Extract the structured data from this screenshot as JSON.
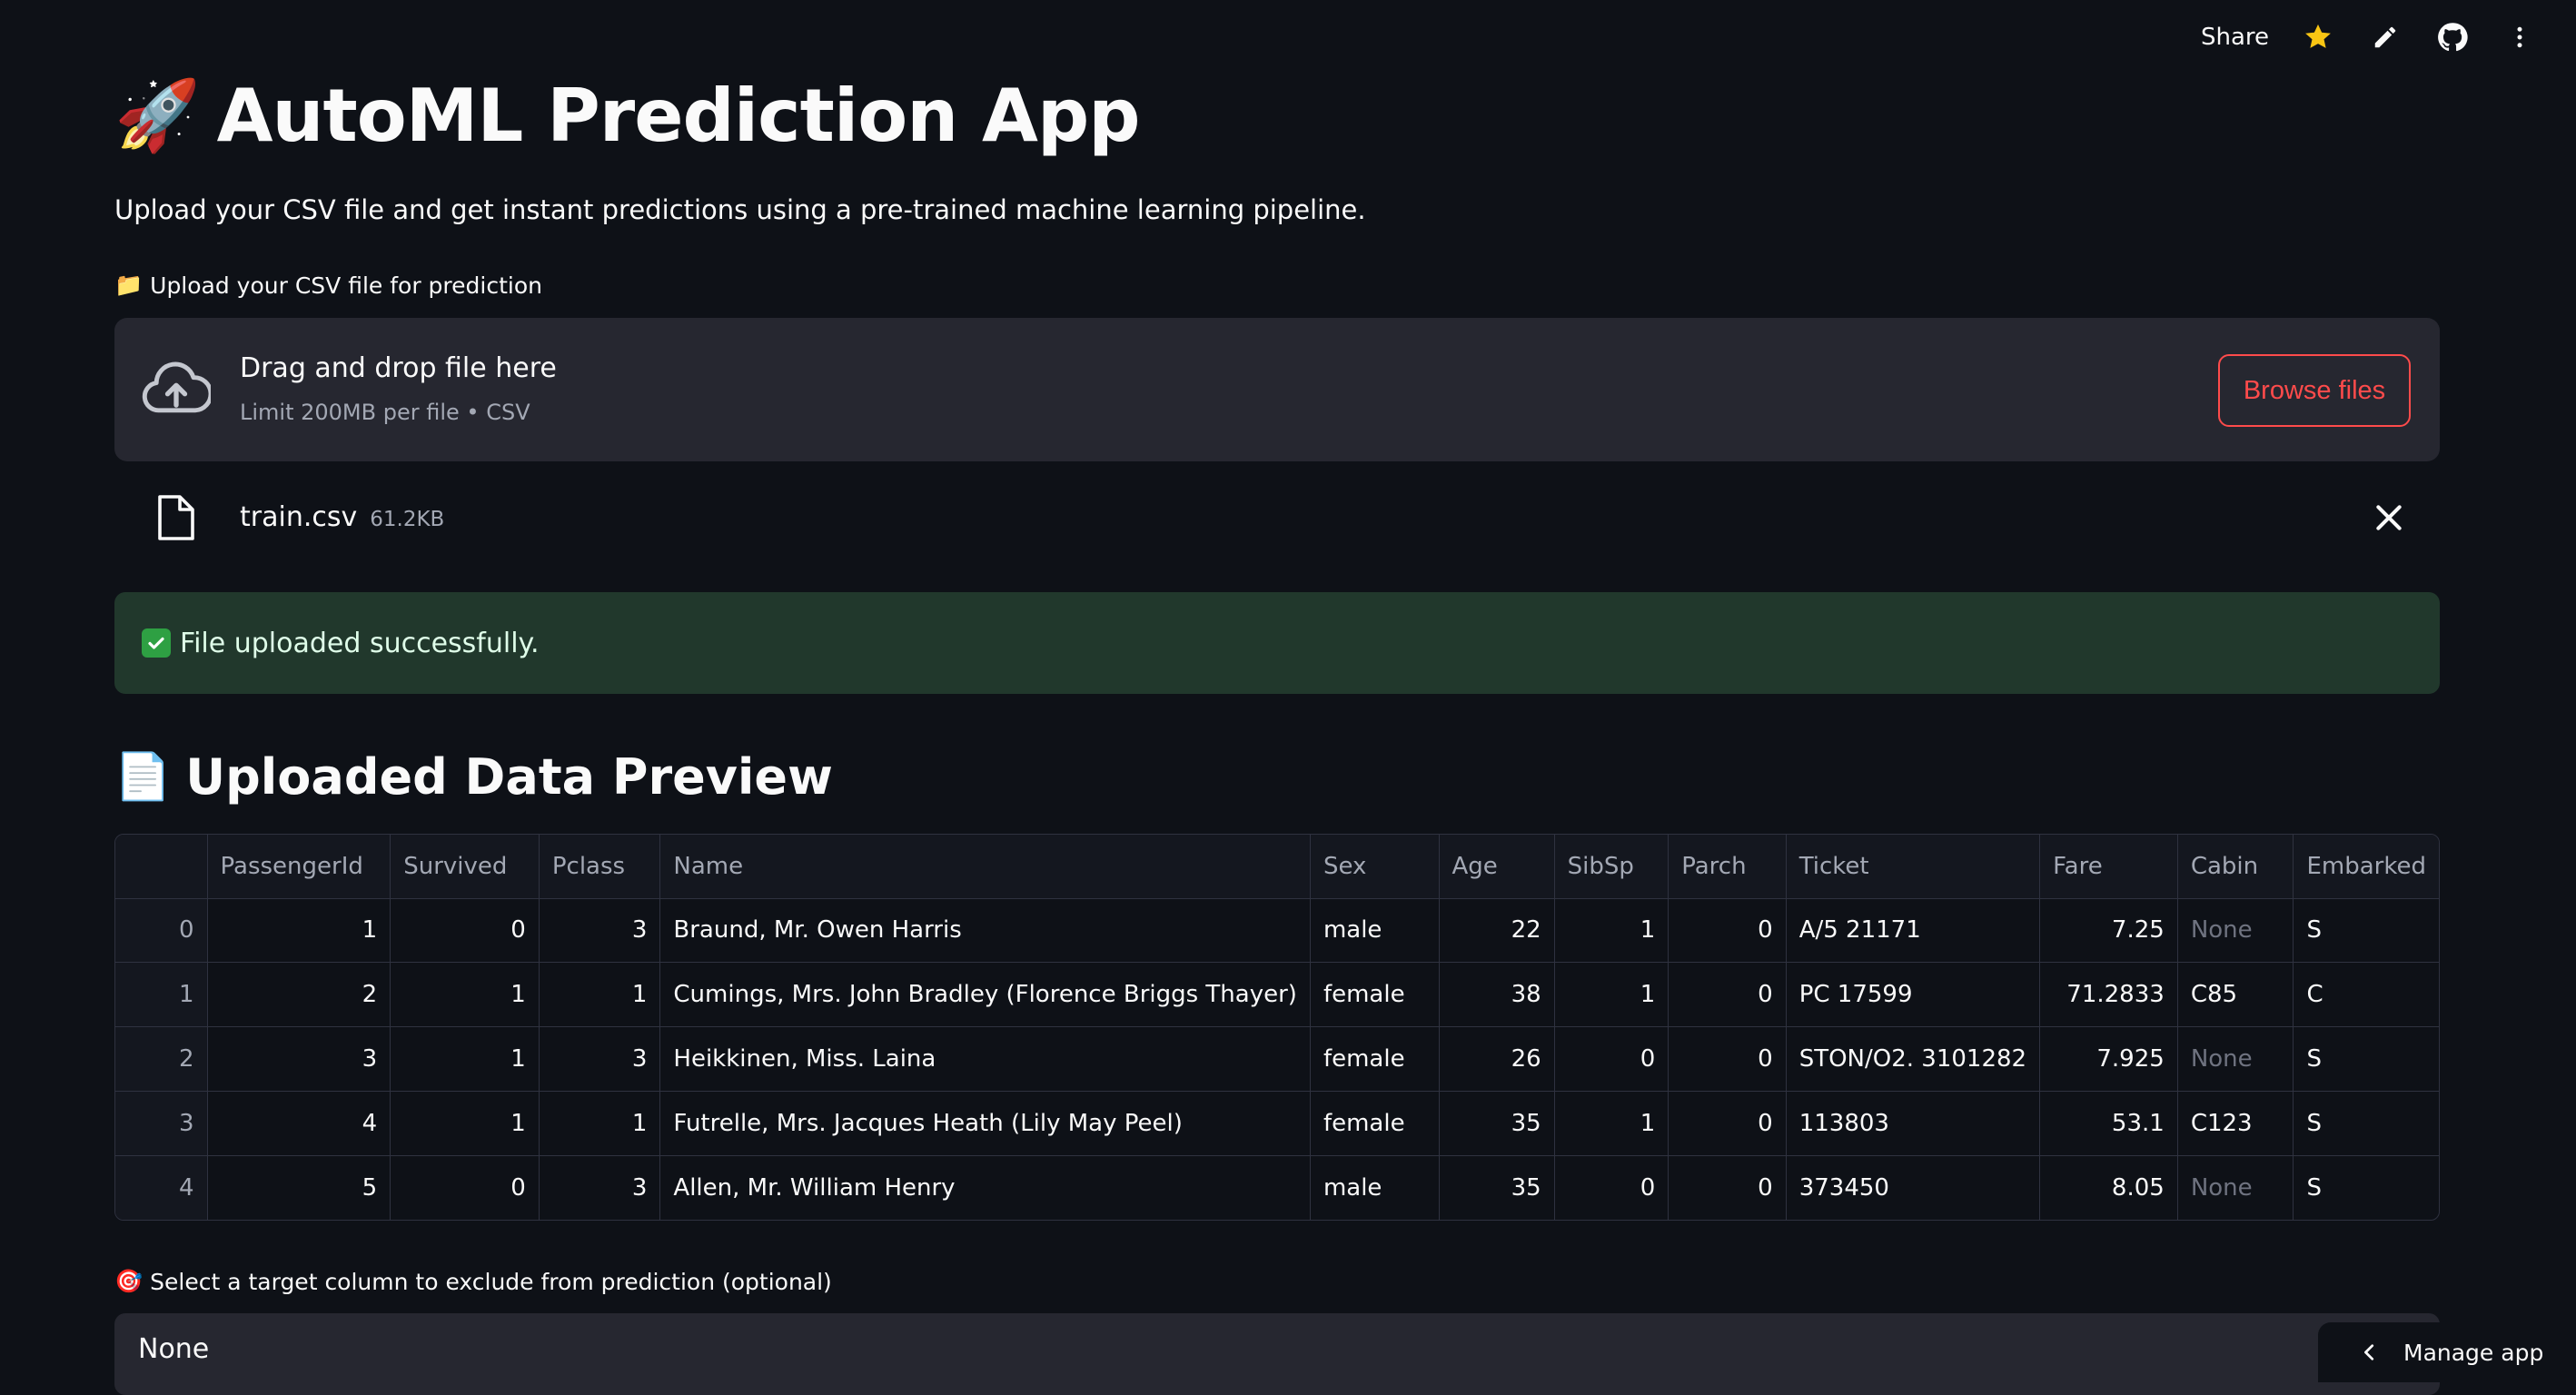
{
  "toolbar": {
    "share_label": "Share",
    "icons": [
      "star-icon",
      "edit-icon",
      "github-icon",
      "more-vertical-icon"
    ],
    "star_color": "#f9c513"
  },
  "header": {
    "emoji": "🚀",
    "title": "AutoML Prediction App",
    "subtitle": "Upload your CSV file and get instant predictions using a pre-trained machine learning pipeline."
  },
  "uploader": {
    "label_emoji": "📁",
    "label": "Upload your CSV file for prediction",
    "drop_title": "Drag and drop file here",
    "drop_limit": "Limit 200MB per file • CSV",
    "browse_label": "Browse files",
    "file": {
      "name": "train.csv",
      "size": "61.2KB"
    }
  },
  "status": {
    "message": "File uploaded successfully."
  },
  "preview": {
    "emoji": "📄",
    "title": "Uploaded Data Preview",
    "columns": [
      "",
      "PassengerId",
      "Survived",
      "Pclass",
      "Name",
      "Sex",
      "Age",
      "SibSp",
      "Parch",
      "Ticket",
      "Fare",
      "Cabin",
      "Embarked"
    ],
    "rows": [
      [
        "0",
        "1",
        "0",
        "3",
        "Braund, Mr. Owen Harris",
        "male",
        "22",
        "1",
        "0",
        "A/5 21171",
        "7.25",
        "None",
        "S"
      ],
      [
        "1",
        "2",
        "1",
        "1",
        "Cumings, Mrs. John Bradley (Florence Briggs Thayer)",
        "female",
        "38",
        "1",
        "0",
        "PC 17599",
        "71.2833",
        "C85",
        "C"
      ],
      [
        "2",
        "3",
        "1",
        "3",
        "Heikkinen, Miss. Laina",
        "female",
        "26",
        "0",
        "0",
        "STON/O2. 3101282",
        "7.925",
        "None",
        "S"
      ],
      [
        "3",
        "4",
        "1",
        "1",
        "Futrelle, Mrs. Jacques Heath (Lily May Peel)",
        "female",
        "35",
        "1",
        "0",
        "113803",
        "53.1",
        "C123",
        "S"
      ],
      [
        "4",
        "5",
        "0",
        "3",
        "Allen, Mr. William Henry",
        "male",
        "35",
        "0",
        "0",
        "373450",
        "8.05",
        "None",
        "S"
      ]
    ]
  },
  "target": {
    "label_emoji": "🎯",
    "label": "Select a target column to exclude from prediction (optional)",
    "selected": "None"
  },
  "manage": {
    "label": "Manage app"
  },
  "colors": {
    "accent": "#ff4b4b",
    "success_bg": "#21382c",
    "panel": "#262730",
    "background": "#0e1117"
  }
}
